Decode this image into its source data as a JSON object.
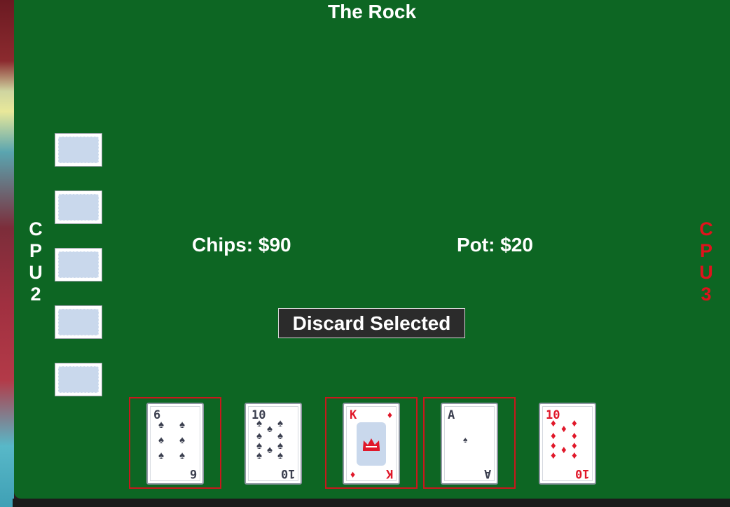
{
  "title": "The Rock",
  "cpu2": {
    "letters": [
      "C",
      "P",
      "U",
      "2"
    ]
  },
  "cpu3": {
    "letters": [
      "C",
      "P",
      "U",
      "3"
    ]
  },
  "chips_text": "Chips: $90",
  "pot_text": "Pot: $20",
  "discard_label": "Discard Selected",
  "cpu2_hidden_cards": 5,
  "player_hand": [
    {
      "rank": "6",
      "suit": "spades",
      "color": "black",
      "selected": true
    },
    {
      "rank": "10",
      "suit": "spades",
      "color": "black",
      "selected": false
    },
    {
      "rank": "K",
      "suit": "diamonds",
      "color": "red",
      "selected": true
    },
    {
      "rank": "A",
      "suit": "spades",
      "color": "black",
      "selected": true
    },
    {
      "rank": "10",
      "suit": "diamonds",
      "color": "red",
      "selected": false
    }
  ],
  "colors": {
    "table": "#0d6623",
    "selection": "#c8181c",
    "cpu3_label": "#e0121c"
  }
}
